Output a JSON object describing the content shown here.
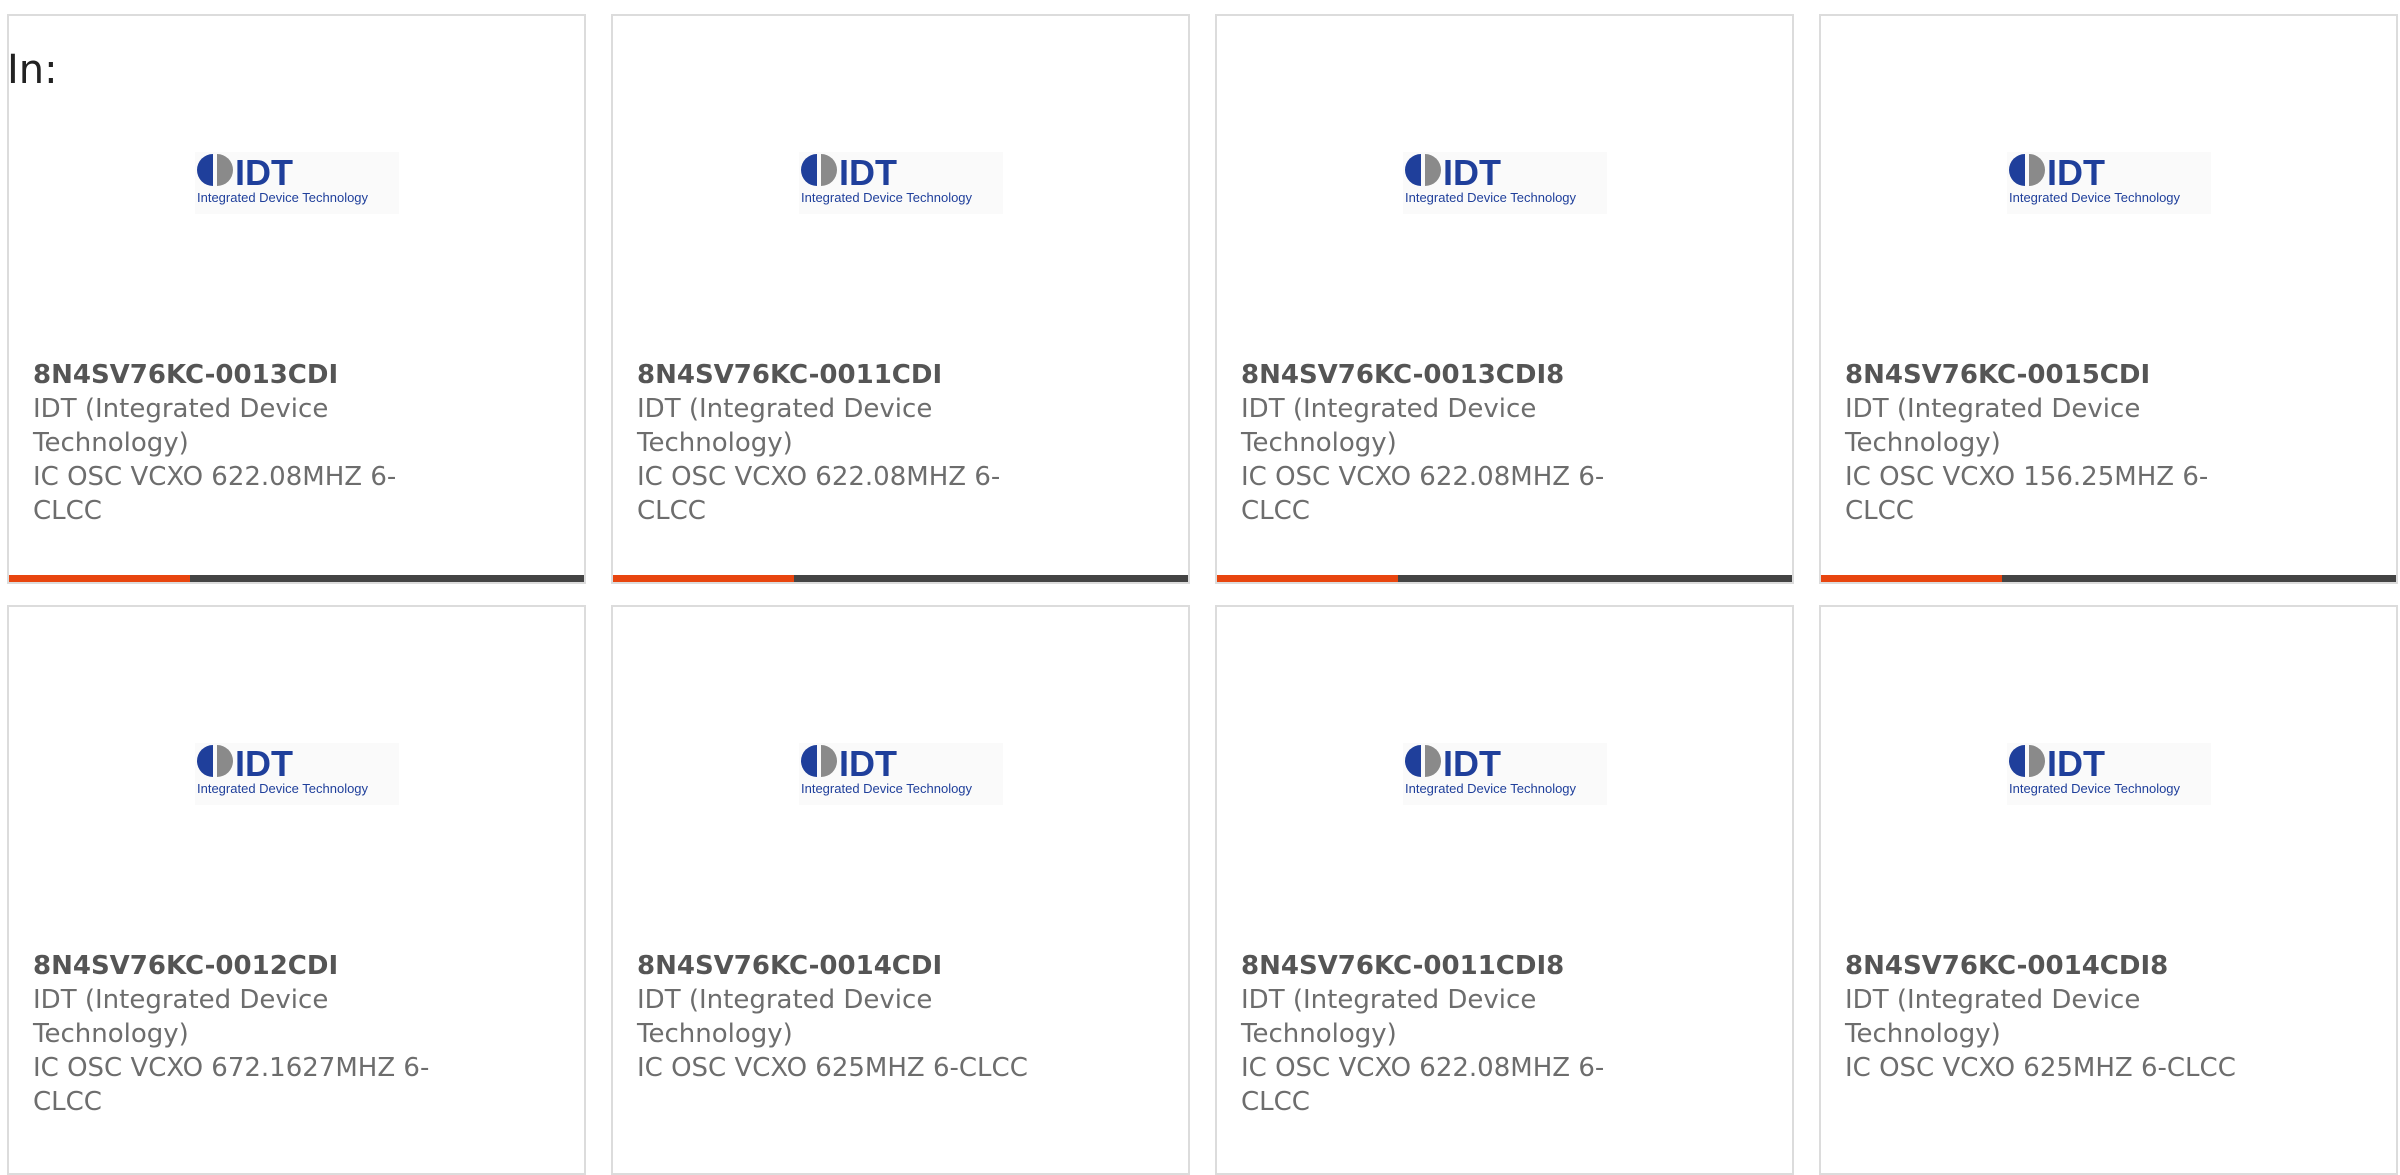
{
  "heading": "In:",
  "colors": {
    "accent": "#e8450f",
    "bar_track": "#444444",
    "logo_blue": "#1f3f9b"
  },
  "logo": {
    "name": "idt-logo",
    "wordmark": "IDT",
    "tagline": "Integrated Device Technology"
  },
  "products": [
    {
      "part_number": "8N4SV76KC-0013CDI",
      "manufacturer": "IDT (Integrated Device Technology)",
      "description": "IC OSC VCXO 622.08MHZ 6-CLCC",
      "bar_fill": 0.315
    },
    {
      "part_number": "8N4SV76KC-0011CDI",
      "manufacturer": "IDT (Integrated Device Technology)",
      "description": "IC OSC VCXO 622.08MHZ 6-CLCC",
      "bar_fill": 0.315
    },
    {
      "part_number": "8N4SV76KC-0013CDI8",
      "manufacturer": "IDT (Integrated Device Technology)",
      "description": "IC OSC VCXO 622.08MHZ 6-CLCC",
      "bar_fill": 0.315
    },
    {
      "part_number": "8N4SV76KC-0015CDI",
      "manufacturer": "IDT (Integrated Device Technology)",
      "description": "IC OSC VCXO 156.25MHZ 6-CLCC",
      "bar_fill": 0.315
    },
    {
      "part_number": "8N4SV76KC-0012CDI",
      "manufacturer": "IDT (Integrated Device Technology)",
      "description": "IC OSC VCXO 672.1627MHZ 6-CLCC"
    },
    {
      "part_number": "8N4SV76KC-0014CDI",
      "manufacturer": "IDT (Integrated Device Technology)",
      "description": "IC OSC VCXO 625MHZ 6-CLCC"
    },
    {
      "part_number": "8N4SV76KC-0011CDI8",
      "manufacturer": "IDT (Integrated Device Technology)",
      "description": "IC OSC VCXO 622.08MHZ 6-CLCC"
    },
    {
      "part_number": "8N4SV76KC-0014CDI8",
      "manufacturer": "IDT (Integrated Device Technology)",
      "description": "IC OSC VCXO 625MHZ 6-CLCC"
    }
  ]
}
